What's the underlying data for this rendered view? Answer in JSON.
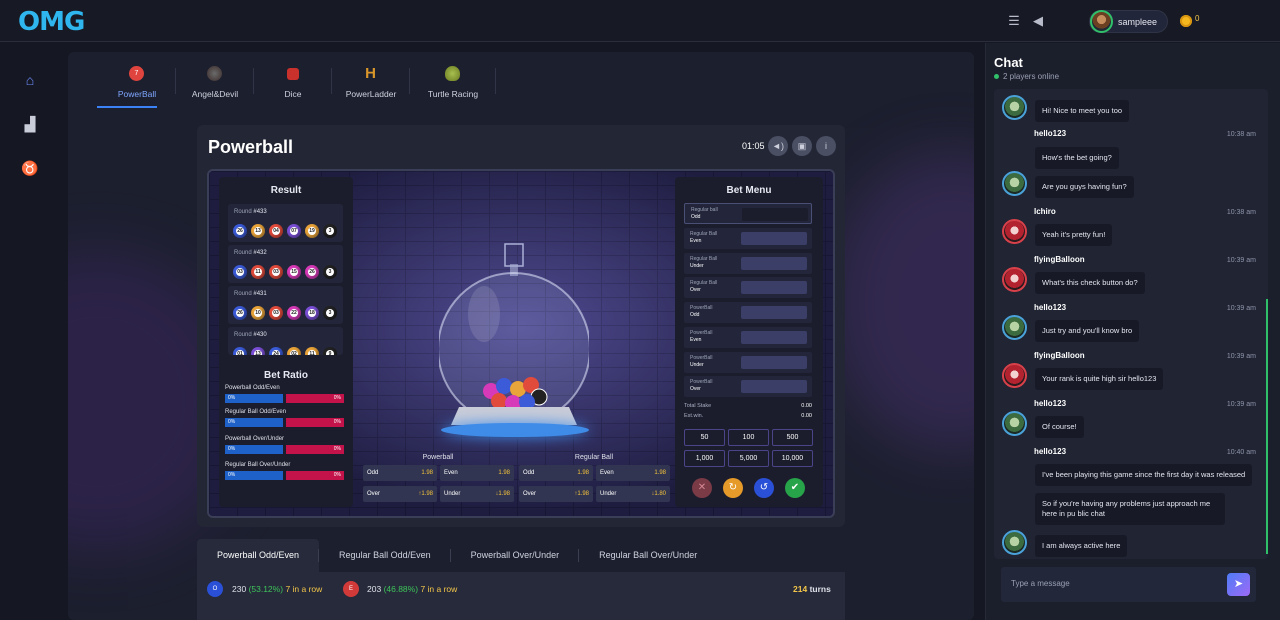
{
  "header": {
    "logo": "OMG",
    "username": "sampleee",
    "coins": "0"
  },
  "game_tabs": [
    {
      "label": "PowerBall"
    },
    {
      "label": "Angel&Devil"
    },
    {
      "label": "Dice"
    },
    {
      "label": "PowerLadder"
    },
    {
      "label": "Turtle Racing"
    }
  ],
  "game": {
    "title": "Powerball",
    "timer": "01:05",
    "result_title": "Result",
    "rounds": [
      {
        "label": "Round",
        "num": "#433",
        "balls": [
          "26",
          "13",
          "04",
          "07",
          "19",
          "3"
        ]
      },
      {
        "label": "Round",
        "num": "#432",
        "balls": [
          "03",
          "11",
          "03",
          "15",
          "26",
          "3"
        ]
      },
      {
        "label": "Round",
        "num": "#431",
        "balls": [
          "26",
          "10",
          "03",
          "22",
          "18",
          "3"
        ]
      },
      {
        "label": "Round",
        "num": "#430",
        "balls": [
          "01",
          "13",
          "24",
          "02",
          "11",
          "9"
        ]
      }
    ],
    "ratio_title": "Bet Ratio",
    "ratios": [
      {
        "label": "Powerball Odd/Even",
        "left": "0%",
        "right": "0%"
      },
      {
        "label": "Regular Ball Odd/Even",
        "left": "0%",
        "right": "0%"
      },
      {
        "label": "Powerball Over/Under",
        "left": "0%",
        "right": "0%"
      },
      {
        "label": "Regular Ball Over/Under",
        "left": "0%",
        "right": "0%"
      }
    ],
    "bet_menu_title": "Bet Menu",
    "bet_rows": [
      {
        "top": "Regular ball",
        "bottom": "Odd"
      },
      {
        "top": "Regular Ball",
        "bottom": "Even"
      },
      {
        "top": "Regular Ball",
        "bottom": "Under"
      },
      {
        "top": "Regular Ball",
        "bottom": "Over"
      },
      {
        "top": "PowerBall",
        "bottom": "Odd"
      },
      {
        "top": "PowerBall",
        "bottom": "Even"
      },
      {
        "top": "PowerBall",
        "bottom": "Under"
      },
      {
        "top": "PowerBall",
        "bottom": "Over"
      }
    ],
    "total_stake_label": "Total Stake",
    "total_stake": "0.00",
    "est_win_label": "Est.win.",
    "est_win": "0.00",
    "chips": [
      "50",
      "100",
      "500",
      "1,000",
      "5,000",
      "10,000"
    ],
    "odds": {
      "powerball_title": "Powerball",
      "regular_title": "Regular Ball",
      "cells": [
        {
          "label": "Odd",
          "val": "1.98"
        },
        {
          "label": "Even",
          "val": "1.98"
        },
        {
          "label": "Odd",
          "val": "1.98"
        },
        {
          "label": "Even",
          "val": "1.98"
        },
        {
          "label": "Over",
          "val": "↑1.98"
        },
        {
          "label": "Under",
          "val": "↓1.98"
        },
        {
          "label": "Over",
          "val": "↑1.98"
        },
        {
          "label": "Under",
          "val": "↓1.80"
        }
      ]
    }
  },
  "bottom_tabs": [
    "Powerball Odd/Even",
    "Regular Ball Odd/Even",
    "Powerball Over/Under",
    "Regular Ball Over/Under"
  ],
  "stats": {
    "odd_icon": "O",
    "odd_count": "230",
    "odd_pct": "(53.12%)",
    "odd_row": "7 in a row",
    "even_icon": "E",
    "even_count": "203",
    "even_pct": "(46.88%)",
    "even_row": "7 in a row",
    "turns": "214",
    "turns_label": "turns"
  },
  "chat": {
    "title": "Chat",
    "online": "2 players online",
    "input_placeholder": "Type a message",
    "messages": [
      {
        "text": "Hi! Nice to meet you too"
      },
      {
        "user": "hello123",
        "time": "10:38 am",
        "text": "How's the bet going?"
      },
      {
        "text": "Are you guys having fun?"
      },
      {
        "user": "Ichiro",
        "time": "10:38 am",
        "text": "Yeah it's pretty fun!"
      },
      {
        "user": "flyingBalloon",
        "time": "10:39 am",
        "text": "What's this check button do?"
      },
      {
        "user": "hello123",
        "time": "10:39 am",
        "text": "Just try and you'll know bro"
      },
      {
        "user": "flyingBalloon",
        "time": "10:39 am",
        "text": "Your rank is quite high sir hello123"
      },
      {
        "user": "hello123",
        "time": "10:39 am",
        "text": "Of course!"
      },
      {
        "user": "hello123",
        "time": "10:40 am",
        "text": "I've been playing this game since the first day it was released"
      },
      {
        "text": "So if you're having any problems just approach me here in pu blic chat"
      },
      {
        "text": "I am always active here"
      }
    ]
  },
  "colors": {
    "accent": "#3b82f6",
    "odd_blue": "#1e62c9",
    "even_red": "#c4124a",
    "online_green": "#31c06a",
    "coin": "#f6b81f"
  },
  "icons": [
    "list-icon",
    "megaphone-icon",
    "home-icon",
    "ranking-icon",
    "zodiac-icon",
    "sound-icon",
    "rules-icon",
    "info-icon",
    "send-icon"
  ]
}
